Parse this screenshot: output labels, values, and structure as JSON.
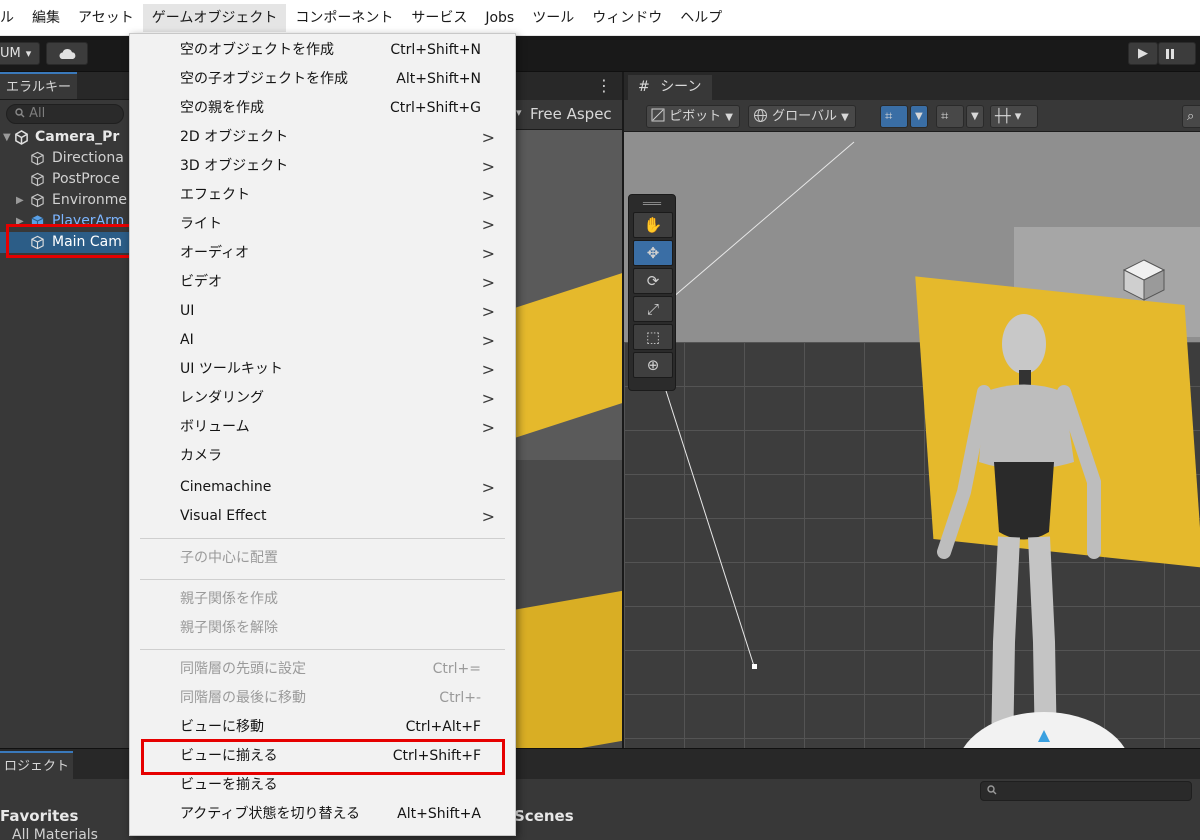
{
  "menubar": {
    "items": [
      "ル",
      "編集",
      "アセット",
      "ゲームオブジェクト",
      "コンポーネント",
      "サービス",
      "Jobs",
      "ツール",
      "ウィンドウ",
      "ヘルプ"
    ],
    "active_index": 3
  },
  "toolbar": {
    "account_label": "UM",
    "account_caret": "▾",
    "cloud_icon": "cloud-icon",
    "play_icon": "▶"
  },
  "hierarchy": {
    "tab_label": "エラルキー",
    "search_placeholder": "All",
    "items": [
      {
        "label": "Camera_Pr",
        "arrow": "▼"
      },
      {
        "label": "Directiona"
      },
      {
        "label": "PostProce"
      },
      {
        "label": "Environme",
        "arrow": "▶"
      },
      {
        "label": "PlayerArm",
        "arrow": "▶"
      },
      {
        "label": "Main Cam"
      }
    ],
    "more_icon": "⋮"
  },
  "game_view": {
    "aspect_label": "Free Aspec",
    "caret": "▾"
  },
  "scene_view": {
    "tab_label": "シーン",
    "tab_icon": "#",
    "pivot_label": "ピボット",
    "global_label": "グローバル",
    "tools": [
      "hand-tool",
      "move-tool",
      "rotate-tool",
      "scale-tool",
      "rect-tool",
      "transform-tool"
    ]
  },
  "project": {
    "tab_label": "ロジェクト",
    "favorites_label": "Favorites",
    "all_materials_label": "All Materials",
    "scenes_label": "Scenes",
    "search_icon": "search-icon"
  },
  "context_menu": {
    "group1": [
      {
        "label": "空のオブジェクトを作成",
        "shortcut": "Ctrl+Shift+N"
      },
      {
        "label": "空の子オブジェクトを作成",
        "shortcut": "Alt+Shift+N"
      },
      {
        "label": "空の親を作成",
        "shortcut": "Ctrl+Shift+G"
      },
      {
        "label": "2D オブジェクト",
        "submenu": ">"
      },
      {
        "label": "3D オブジェクト",
        "submenu": ">"
      },
      {
        "label": "エフェクト",
        "submenu": ">"
      },
      {
        "label": "ライト",
        "submenu": ">"
      },
      {
        "label": "オーディオ",
        "submenu": ">"
      },
      {
        "label": "ビデオ",
        "submenu": ">"
      },
      {
        "label": "UI",
        "submenu": ">"
      },
      {
        "label": "AI",
        "submenu": ">"
      },
      {
        "label": "UI ツールキット",
        "submenu": ">"
      },
      {
        "label": "レンダリング",
        "submenu": ">"
      },
      {
        "label": "ボリューム",
        "submenu": ">"
      },
      {
        "label": "カメラ"
      },
      {
        "label": "Cinemachine",
        "submenu": ">"
      },
      {
        "label": "Visual Effect",
        "submenu": ">"
      }
    ],
    "group2": [
      {
        "label": "子の中心に配置"
      }
    ],
    "group3": [
      {
        "label": "親子関係を作成"
      },
      {
        "label": "親子関係を解除"
      }
    ],
    "group4": [
      {
        "label": "同階層の先頭に設定",
        "shortcut": "Ctrl+="
      },
      {
        "label": "同階層の最後に移動",
        "shortcut": "Ctrl+-"
      },
      {
        "label": "ビューに移動",
        "shortcut": "Ctrl+Alt+F"
      },
      {
        "label": "ビューに揃える",
        "shortcut": "Ctrl+Shift+F"
      },
      {
        "label": "ビューを揃える"
      },
      {
        "label": "アクティブ状態を切り替える",
        "shortcut": "Alt+Shift+A"
      }
    ]
  },
  "colors": {
    "highlight_box": "#e60000",
    "selection": "#2c5d87",
    "accent": "#3a6ea5",
    "object_yellow": "#e5b92c"
  }
}
